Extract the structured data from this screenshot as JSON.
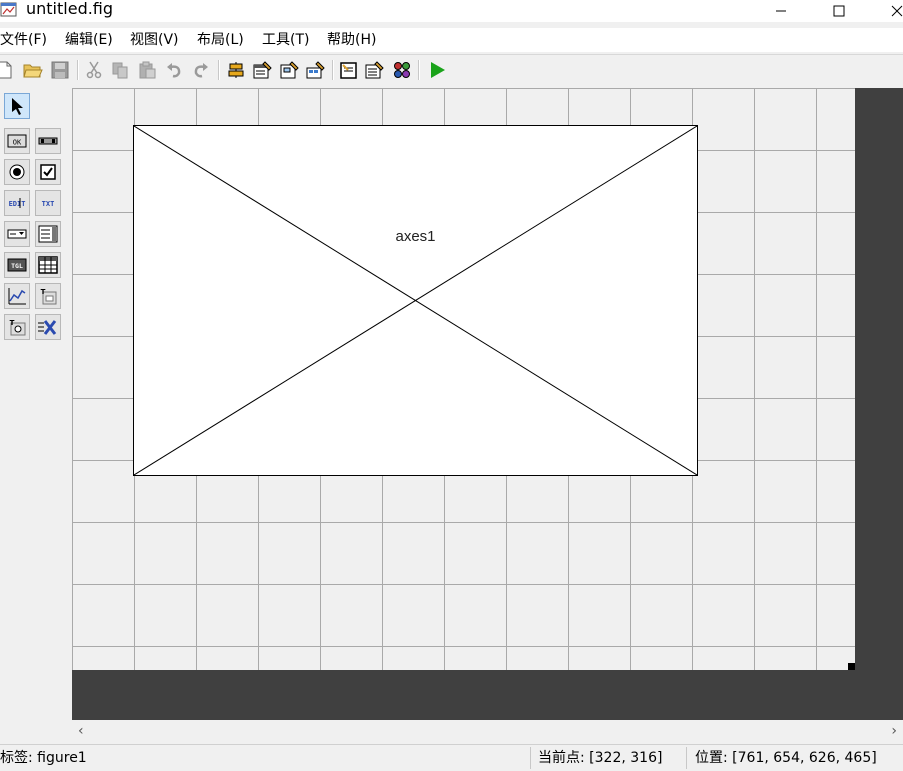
{
  "window": {
    "title": "untitled.fig",
    "controls": {
      "minimize": "—",
      "maximize": "☐",
      "close": "✕"
    }
  },
  "menu": {
    "items": [
      "文件(F)",
      "编辑(E)",
      "视图(V)",
      "布局(L)",
      "工具(T)",
      "帮助(H)"
    ]
  },
  "toolbar": {
    "buttons": [
      "new-figure-icon",
      "open-file-icon",
      "save-icon",
      "cut-icon",
      "copy-icon",
      "paste-icon",
      "undo-icon",
      "redo-icon",
      "align-objects-icon",
      "menu-editor-icon",
      "tab-order-editor-icon",
      "toolbar-editor-icon",
      "editor-icon",
      "property-inspector-icon",
      "object-browser-icon",
      "run-figure-icon"
    ]
  },
  "palette": {
    "tools": [
      "select-tool-icon",
      "push-button-icon",
      "slider-icon",
      "radio-button-icon",
      "check-box-icon",
      "edit-text-icon",
      "static-text-icon",
      "popup-menu-icon",
      "listbox-icon",
      "toggle-button-icon",
      "table-icon",
      "axes-icon",
      "panel-icon",
      "button-group-icon",
      "activex-control-icon"
    ],
    "labels": {
      "ok": "OK",
      "edit": "EDIT",
      "txt": "TXT",
      "tgl": "TGL",
      "t": "T"
    }
  },
  "canvas": {
    "axes_label": "axes1"
  },
  "scrollbar": {
    "left": "‹",
    "right": "›"
  },
  "status": {
    "tag_label": "标签:",
    "tag_value": "figure1",
    "current_point_label": "当前点:",
    "current_point_value": "[322, 316]",
    "position_label": "位置:",
    "position_value": "[761, 654, 626, 465]"
  },
  "colors": {
    "canvas_border": "#404040",
    "grid_background": "#f0f0f0",
    "grid_line": "#a9a9a9",
    "run_green": "#1aa31a"
  }
}
